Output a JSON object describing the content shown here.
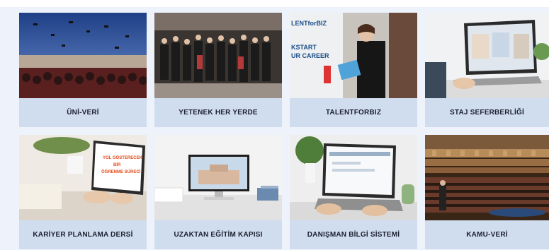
{
  "cards": [
    {
      "label": "ÜNİ-VERİ",
      "image": "graduation-photo"
    },
    {
      "label": "YETENEK HER YERDE",
      "image": "group-photo"
    },
    {
      "label": "TALENTFORBIZ",
      "image": "brochure-photo",
      "banner_lines": [
        "LENTforBIZ",
        "KSTART",
        "UR CAREER"
      ]
    },
    {
      "label": "STAJ SEFERBERLİĞİ",
      "image": "laptop-video-call-photo"
    },
    {
      "label": "KARİYER PLANLAMA DERSİ",
      "image": "laptop-desk-photo",
      "screen_lines": [
        "YOL GÖSTERECEK",
        "BİR",
        "ÖĞRENME SÜRECİ"
      ]
    },
    {
      "label": "UZAKTAN EĞİTİM KAPISI",
      "image": "monitor-building-photo"
    },
    {
      "label": "DANIŞMAN BİLGİ SİSTEMİ",
      "image": "laptop-plant-photo"
    },
    {
      "label": "KAMU-VERİ",
      "image": "concert-hall-photo"
    }
  ]
}
